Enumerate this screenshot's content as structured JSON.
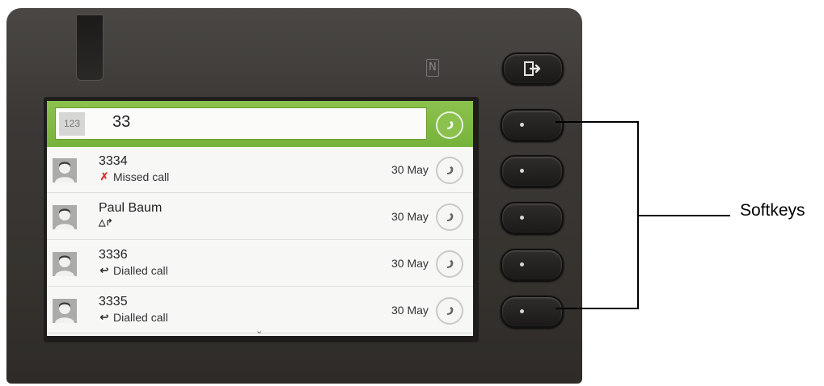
{
  "input": {
    "mode_badge": "123",
    "value": "33"
  },
  "nfc_symbol": "N",
  "entries": [
    {
      "name": "3334",
      "status": "Missed call",
      "status_icon": "missed-call-icon",
      "date": "30 May"
    },
    {
      "name": "Paul Baum",
      "status": "",
      "status_icon": "forwarded-call-icon",
      "date": "30 May"
    },
    {
      "name": "3336",
      "status": "Dialled call",
      "status_icon": "dialled-call-icon",
      "date": "30 May"
    },
    {
      "name": "3335",
      "status": "Dialled call",
      "status_icon": "dialled-call-icon",
      "date": "30 May"
    }
  ],
  "annotation": {
    "label": "Softkeys"
  },
  "colors": {
    "accent_green": "#8cc14e",
    "missed_red": "#d9332c",
    "phone_body": "#3b3836"
  }
}
